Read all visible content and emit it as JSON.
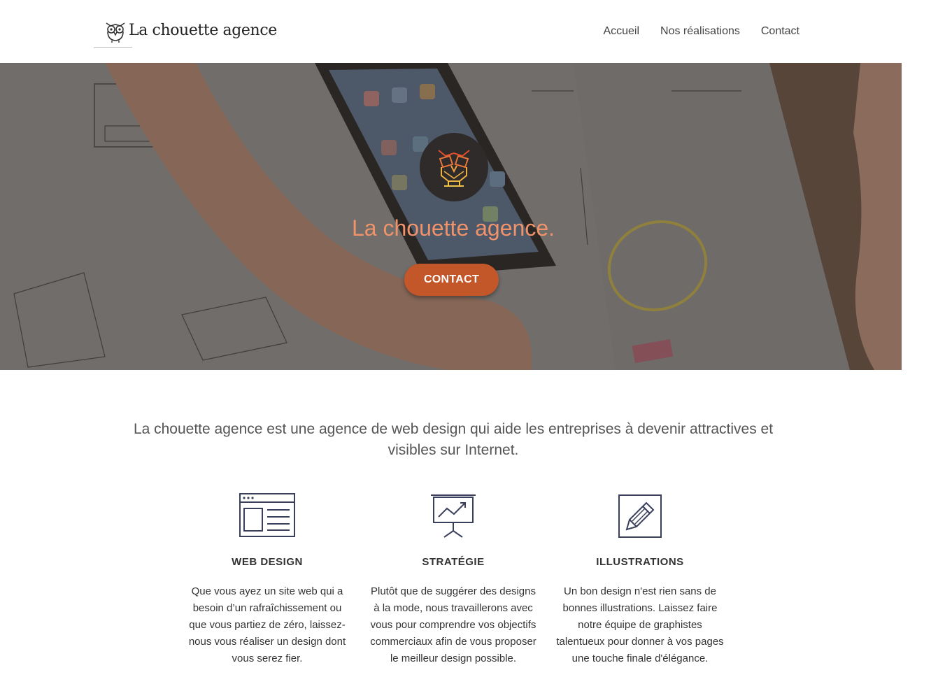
{
  "header": {
    "logo_text": "La chouette agence",
    "nav": [
      "Accueil",
      "Nos réalisations",
      "Contact"
    ]
  },
  "hero": {
    "title": "La chouette agence.",
    "button": "CONTACT"
  },
  "intro": "La chouette agence est une agence de web design qui aide les entreprises à devenir attractives et visibles sur Internet.",
  "features": [
    {
      "icon": "browser-window-icon",
      "title": "WEB DESIGN",
      "text": "Que vous ayez un site web qui a besoin d’un rafraîchissement ou que vous partiez de zéro, laissez-nous vous réaliser un design dont vous serez fier."
    },
    {
      "icon": "presentation-chart-icon",
      "title": "STRATÉGIE",
      "text": "Plutôt que de suggérer des designs à la mode, nous travaillerons avec vous pour comprendre vos objectifs commerciaux afin de vous proposer le meilleur design possible."
    },
    {
      "icon": "pencil-icon",
      "title": "ILLUSTRATIONS",
      "text": "Un bon design n'est rien sans de bonnes illustrations. Laissez faire notre équipe de graphistes talentueux pour donner à vos pages une touche finale d'élégance."
    }
  ],
  "colors": {
    "accent": "#c4572a",
    "hero_title": "#f0926a",
    "icon_stroke": "#3a3f5c"
  }
}
